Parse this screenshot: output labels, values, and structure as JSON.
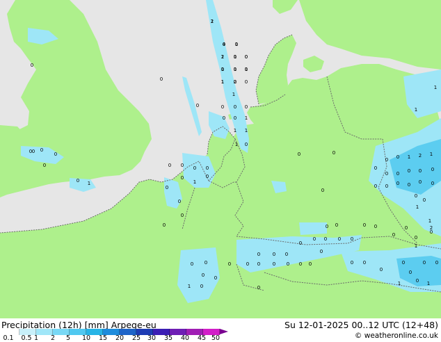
{
  "footer": {
    "title": "Precipitation (12h) [mm] Arpege-eu",
    "valid_time": "Su 12-01-2025 00..12 UTC (12+48)",
    "credit": "© weatheronline.co.uk"
  },
  "legend": {
    "colors": [
      "#ffffff",
      "#c8f0fa",
      "#a0e6f8",
      "#78d8f5",
      "#50c8f0",
      "#28b4e6",
      "#1e8cdc",
      "#1e64c8",
      "#1e3cb4",
      "#3c1eb4",
      "#6e1eb4",
      "#a01eb4",
      "#d21ec8",
      "#e61ea0"
    ],
    "ticks": [
      "0.1",
      "0.5",
      "1",
      "2",
      "5",
      "10",
      "15",
      "20",
      "25",
      "30",
      "35",
      "40",
      "45",
      "50"
    ]
  },
  "map": {
    "colors": {
      "sea": "#e6e6e6",
      "land": "#aef08c",
      "precip_light": "#9ee6f7",
      "precip_mid": "#5ccdf0",
      "border": "#6a6a6a"
    },
    "precip_values": [
      "1",
      "0",
      "0",
      "1",
      "0",
      "0",
      "1",
      "0",
      "0",
      "1",
      "0",
      "0",
      "1",
      "0",
      "0",
      "0",
      "0",
      "0",
      "1",
      "1",
      "1",
      "1",
      "0",
      "0",
      "0",
      "0",
      "0",
      "0",
      "1",
      "0",
      "0",
      "0",
      "0",
      "0",
      "0",
      "0",
      "0",
      "1",
      "0",
      "0",
      "0",
      "0",
      "0",
      "0",
      "0",
      "0",
      "0",
      "0",
      "0",
      "0",
      "0",
      "0",
      "0",
      "0",
      "0",
      "0",
      "0",
      "0",
      "0",
      "0",
      "0",
      "0",
      "0",
      "0",
      "0",
      "0",
      "0",
      "0",
      "0",
      "1",
      "0",
      "0",
      "0",
      "0",
      "0",
      "0",
      "0",
      "1",
      "0",
      "1",
      "0",
      "0",
      "0",
      "1",
      "0",
      "0",
      "0",
      "0",
      "0",
      "0",
      "0",
      "0",
      "0",
      "0",
      "0",
      "0",
      "0",
      "0",
      "0",
      "0",
      "0",
      "0",
      "0",
      "1",
      "2",
      "1",
      "0",
      "0",
      "1",
      "2",
      "1",
      "1",
      "1",
      "2",
      "4",
      "1",
      "2",
      "1",
      "0",
      "0",
      "1",
      "1",
      "1",
      "2"
    ]
  }
}
